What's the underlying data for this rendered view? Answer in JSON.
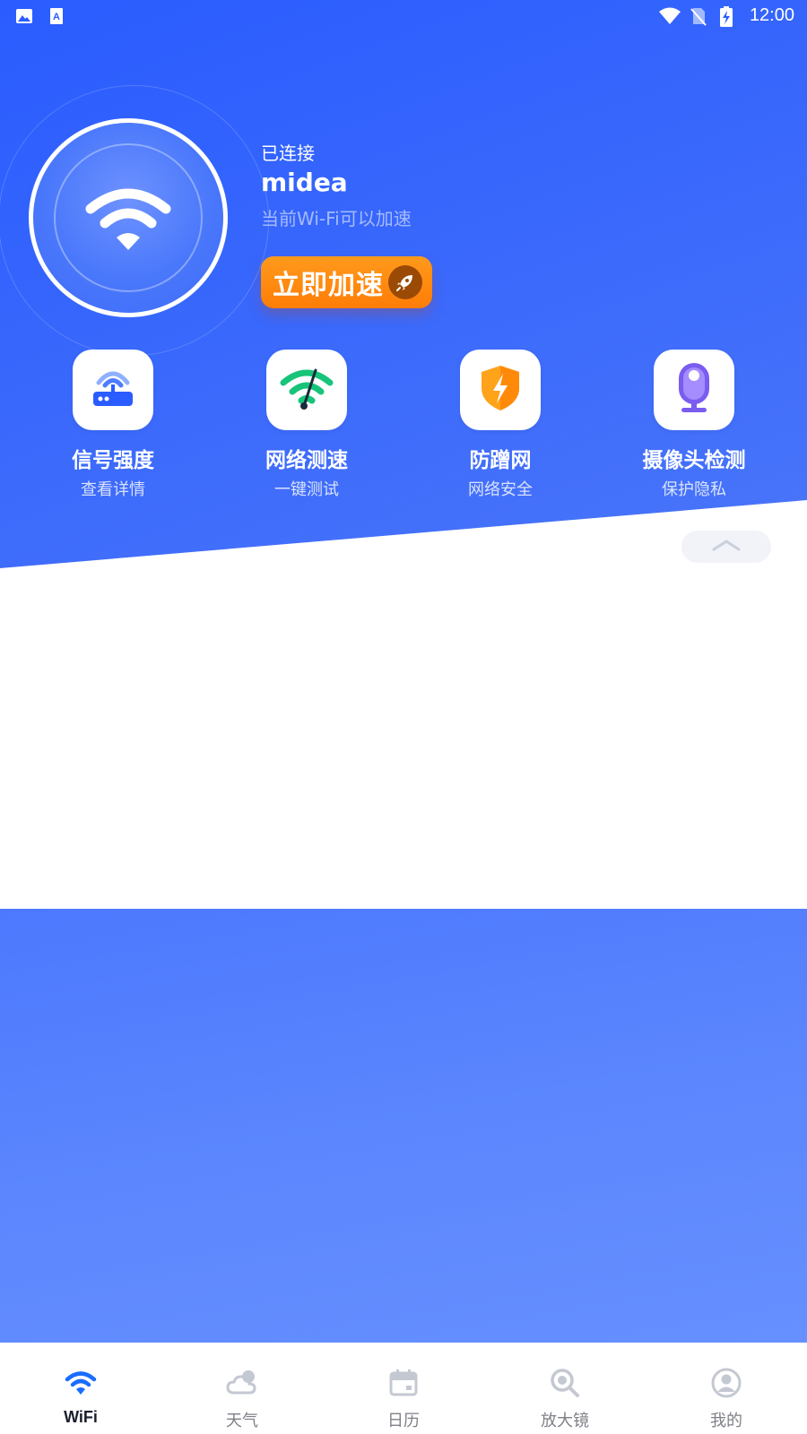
{
  "status_bar": {
    "time": "12:00",
    "left_icons": [
      "image-icon",
      "font-icon"
    ],
    "right_icons": [
      "wifi-signal-icon",
      "no-sim-icon",
      "battery-charging-icon"
    ]
  },
  "connection": {
    "status": "已连接",
    "ssid": "midea",
    "subtitle": "当前Wi-Fi可以加速",
    "boost_label": "立即加速"
  },
  "features": [
    {
      "title": "信号强度",
      "subtitle": "查看详情",
      "icon": "router-icon"
    },
    {
      "title": "网络测速",
      "subtitle": "一键测试",
      "icon": "speed-gauge-icon"
    },
    {
      "title": "防蹭网",
      "subtitle": "网络安全",
      "icon": "shield-icon"
    },
    {
      "title": "摄像头检测",
      "subtitle": "保护隐私",
      "icon": "camera-icon"
    }
  ],
  "bottom_nav": [
    {
      "label": "WiFi",
      "icon": "wifi-icon",
      "active": true
    },
    {
      "label": "天气",
      "icon": "cloud-icon",
      "active": false
    },
    {
      "label": "日历",
      "icon": "calendar-icon",
      "active": false
    },
    {
      "label": "放大镜",
      "icon": "magnifier-icon",
      "active": false
    },
    {
      "label": "我的",
      "icon": "user-icon",
      "active": false
    }
  ],
  "colors": {
    "primary_blue": "#2a5cff",
    "boost_orange": "#ff8a0f",
    "active_nav": "#1a6dff",
    "inactive_nav": "#c4c8d2"
  }
}
